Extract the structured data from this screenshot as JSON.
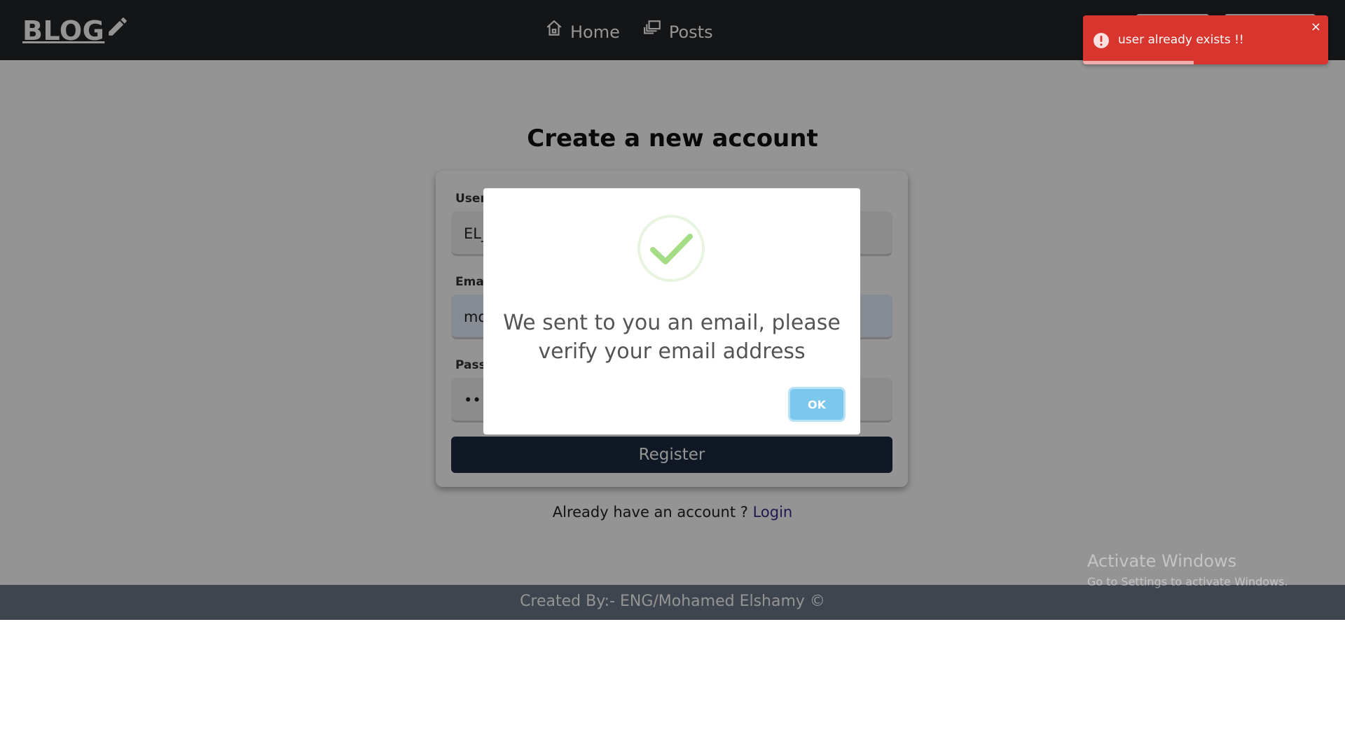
{
  "navbar": {
    "brand": "BLOG",
    "nav_items": [
      {
        "label": "Home",
        "icon": "home-icon"
      },
      {
        "label": "Posts",
        "icon": "posts-icon"
      }
    ]
  },
  "page": {
    "title": "Create a new account",
    "form": {
      "username_label": "Username",
      "username_value": "EL_",
      "email_label": "Email",
      "email_value": "mo",
      "password_label": "Password",
      "password_value": "•••",
      "register_label": "Register"
    },
    "login_prompt": "Already have an account ? ",
    "login_link": "Login"
  },
  "footer": {
    "text": "Created By:- ENG/Mohamed Elshamy ©"
  },
  "modal": {
    "icon": "success-check-icon",
    "message": "We sent to you an email, please verify your email address",
    "ok_label": "OK",
    "accent_color": "#7cc8ec"
  },
  "toast": {
    "icon": "error-icon",
    "message": "user already exists !!",
    "close_glyph": "×",
    "color": "#d9352f",
    "progress_fraction": 0.45
  },
  "watermark": {
    "title": "Activate Windows",
    "subtitle": "Go to Settings to activate Windows."
  }
}
